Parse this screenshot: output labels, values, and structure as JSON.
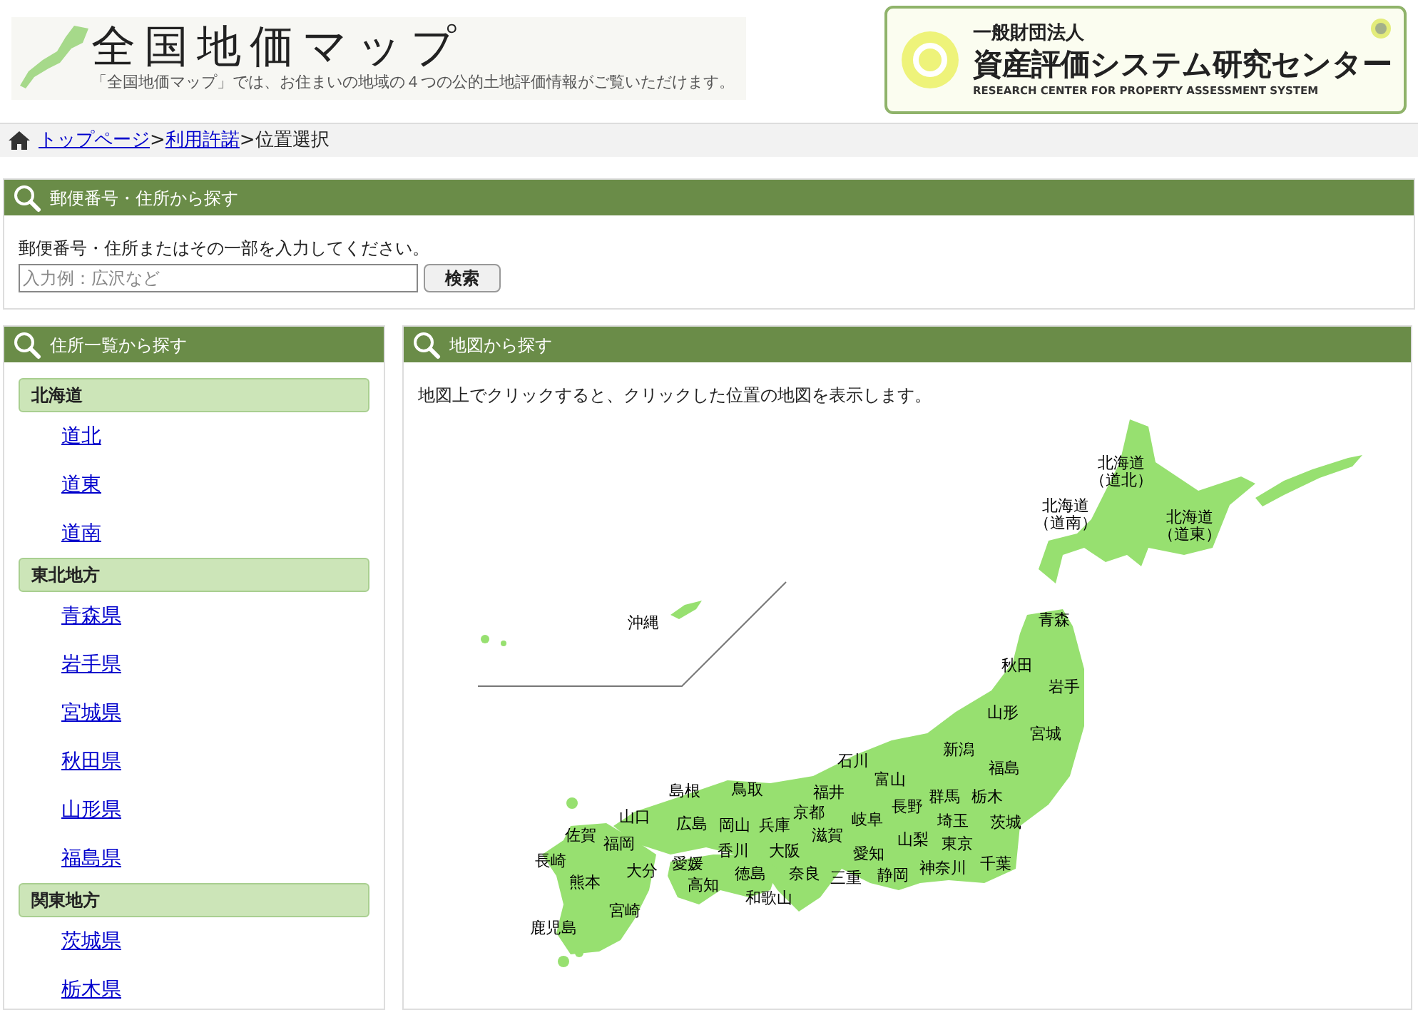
{
  "header": {
    "title": "全国地価マップ",
    "tagline": "「全国地価マップ」では、お住まいの地域の４つの公的土地評価情報がご覧いただけます。",
    "org": {
      "prefix": "一般財団法人",
      "name": "資産評価システム研究センター",
      "english": "RESEARCH CENTER FOR PROPERTY ASSESSMENT SYSTEM"
    }
  },
  "breadcrumb": [
    {
      "label": "トップページ",
      "kind": "link"
    },
    {
      "label": ">",
      "kind": "separator"
    },
    {
      "label": "利用許諾",
      "kind": "link"
    },
    {
      "label": ">",
      "kind": "separator"
    },
    {
      "label": "位置選択",
      "kind": "current"
    }
  ],
  "postal_search": {
    "title": "郵便番号・住所から探す",
    "instruction": "郵便番号・住所またはその一部を入力してください。",
    "placeholder": "入力例：広沢など",
    "button": "検索"
  },
  "address_list": {
    "title": "住所一覧から探す",
    "groups": [
      {
        "label": "北海道",
        "items": [
          "道北",
          "道東",
          "道南"
        ]
      },
      {
        "label": "東北地方",
        "items": [
          "青森県",
          "岩手県",
          "宮城県",
          "秋田県",
          "山形県",
          "福島県"
        ]
      },
      {
        "label": "関東地方",
        "items": [
          "茨城県",
          "栃木県"
        ]
      }
    ]
  },
  "map_search": {
    "title": "地図から探す",
    "instruction": "地図上でクリックすると、クリックした位置の地図を表示します。",
    "labels": [
      "北海道",
      "（道北）",
      "北海道",
      "北海道",
      "（道南）",
      "（道東）",
      "沖縄",
      "青森",
      "秋田",
      "岩手",
      "山形",
      "宮城",
      "石川",
      "新潟",
      "富山",
      "福島",
      "島根",
      "鳥取",
      "福井",
      "群馬",
      "栃木",
      "山口",
      "京都",
      "長野",
      "広島",
      "岡山",
      "兵庫",
      "岐阜",
      "埼玉",
      "茨城",
      "佐賀",
      "福岡",
      "滋賀",
      "山梨",
      "東京",
      "長崎",
      "香川",
      "大阪",
      "愛知",
      "大分",
      "愛媛",
      "徳島",
      "奈良",
      "静岡",
      "神奈川",
      "千葉",
      "熊本",
      "高知",
      "三重",
      "和歌山",
      "宮崎",
      "鹿児島"
    ]
  }
}
